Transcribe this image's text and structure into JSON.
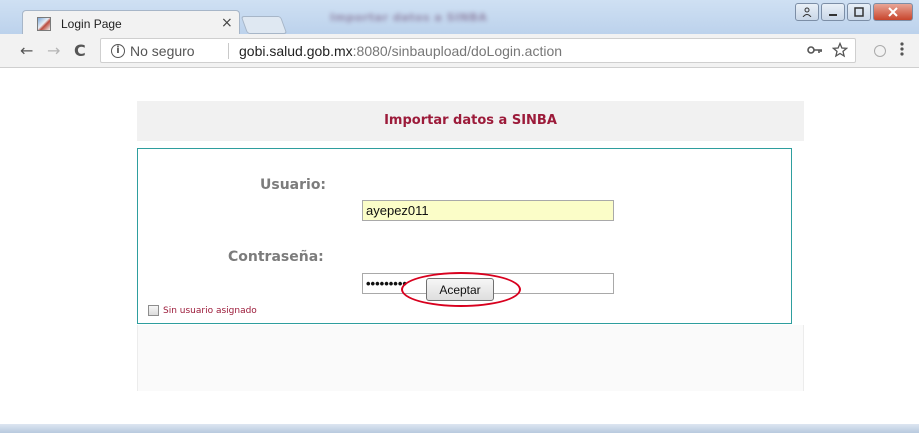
{
  "browser": {
    "window_title": "Importar datos a SINBA",
    "tab_title": "Login Page",
    "tab_close": "×",
    "security_label": "No seguro",
    "url_host": "gobi.salud.gob.mx",
    "url_rest": ":8080/sinbaupload/doLogin.action",
    "nav": {
      "back": "←",
      "forward": "→",
      "reload": "C"
    },
    "icons": {
      "key": "key-icon",
      "star": "star-icon",
      "menu": "kebab-menu-icon"
    },
    "window_buttons": {
      "user": "user-icon",
      "minimize": "minimize-icon",
      "maximize": "maximize-icon",
      "close": "close-icon"
    }
  },
  "page": {
    "header": "Importar datos a SINBA",
    "usuario_label": "Usuario:",
    "usuario_value": "ayepez011",
    "contrasena_label": "Contraseña:",
    "contrasena_value": "•••••••••",
    "checkbox_label": "Sin usuario asignado",
    "submit_label": "Aceptar",
    "colors": {
      "accent": "#9c1b3a",
      "border": "#2e9e9e",
      "highlight": "#d8001e"
    }
  }
}
